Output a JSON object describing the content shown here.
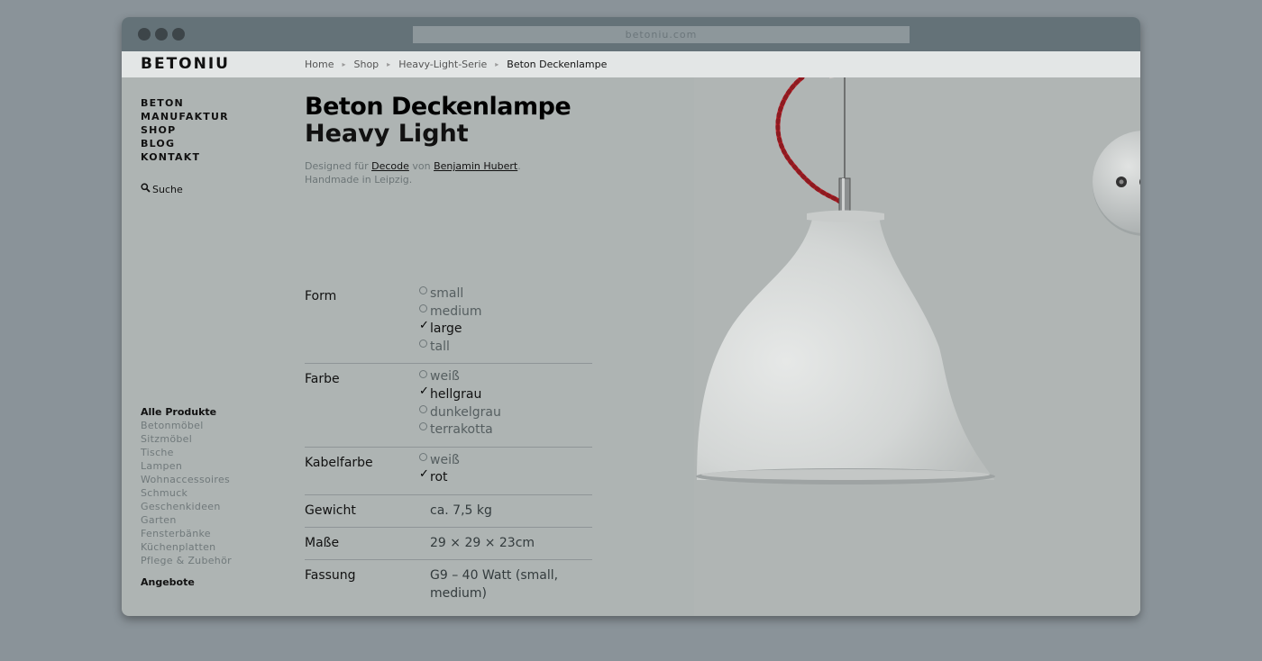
{
  "browser": {
    "url": "betoniu.com"
  },
  "header": {
    "logo": "BETONIU",
    "breadcrumb": [
      "Home",
      "Shop",
      "Heavy-Light-Serie",
      "Beton Deckenlampe"
    ]
  },
  "nav": {
    "items": [
      "BETON",
      "MANUFAKTUR",
      "SHOP",
      "BLOG",
      "KONTAKT"
    ],
    "search": "Suche"
  },
  "categories": {
    "heading": "Alle Produkte",
    "items": [
      "Betonmöbel",
      "Sitzmöbel",
      "Tische",
      "Lampen",
      "Wohnaccessoires",
      "Schmuck",
      "Geschenkideen",
      "Garten",
      "Fensterbänke",
      "Küchenplatten",
      "Pflege & Zubehör"
    ],
    "offers": "Angebote"
  },
  "product": {
    "title": "Beton Deckenlampe",
    "subtitle": "Heavy Light",
    "credit_prefix": "Designed für",
    "credit_brand": "Decode",
    "credit_von": "von",
    "credit_designer": "Benjamin Hubert",
    "credit_dot": ".",
    "credit_line2": "Handmade in Leipzig."
  },
  "specs": {
    "form": {
      "label": "Form",
      "options": [
        "small",
        "medium",
        "large",
        "tall"
      ],
      "selected": "large"
    },
    "farbe": {
      "label": "Farbe",
      "options": [
        "weiß",
        "hellgrau",
        "dunkelgrau",
        "terrakotta"
      ],
      "selected": "hellgrau"
    },
    "kabel": {
      "label": "Kabelfarbe",
      "options": [
        "weiß",
        "rot"
      ],
      "selected": "rot"
    },
    "gewicht": {
      "label": "Gewicht",
      "value": "ca. 7,5 kg"
    },
    "masse": {
      "label": "Maße",
      "value": "29 × 29 × 23cm"
    },
    "fassung": {
      "label": "Fassung",
      "value_line1": "G9 – 40 Watt (small,",
      "value_line2": "medium)"
    }
  },
  "colors": {
    "cable": "#c0242c",
    "concrete": "#d6d8d7"
  }
}
